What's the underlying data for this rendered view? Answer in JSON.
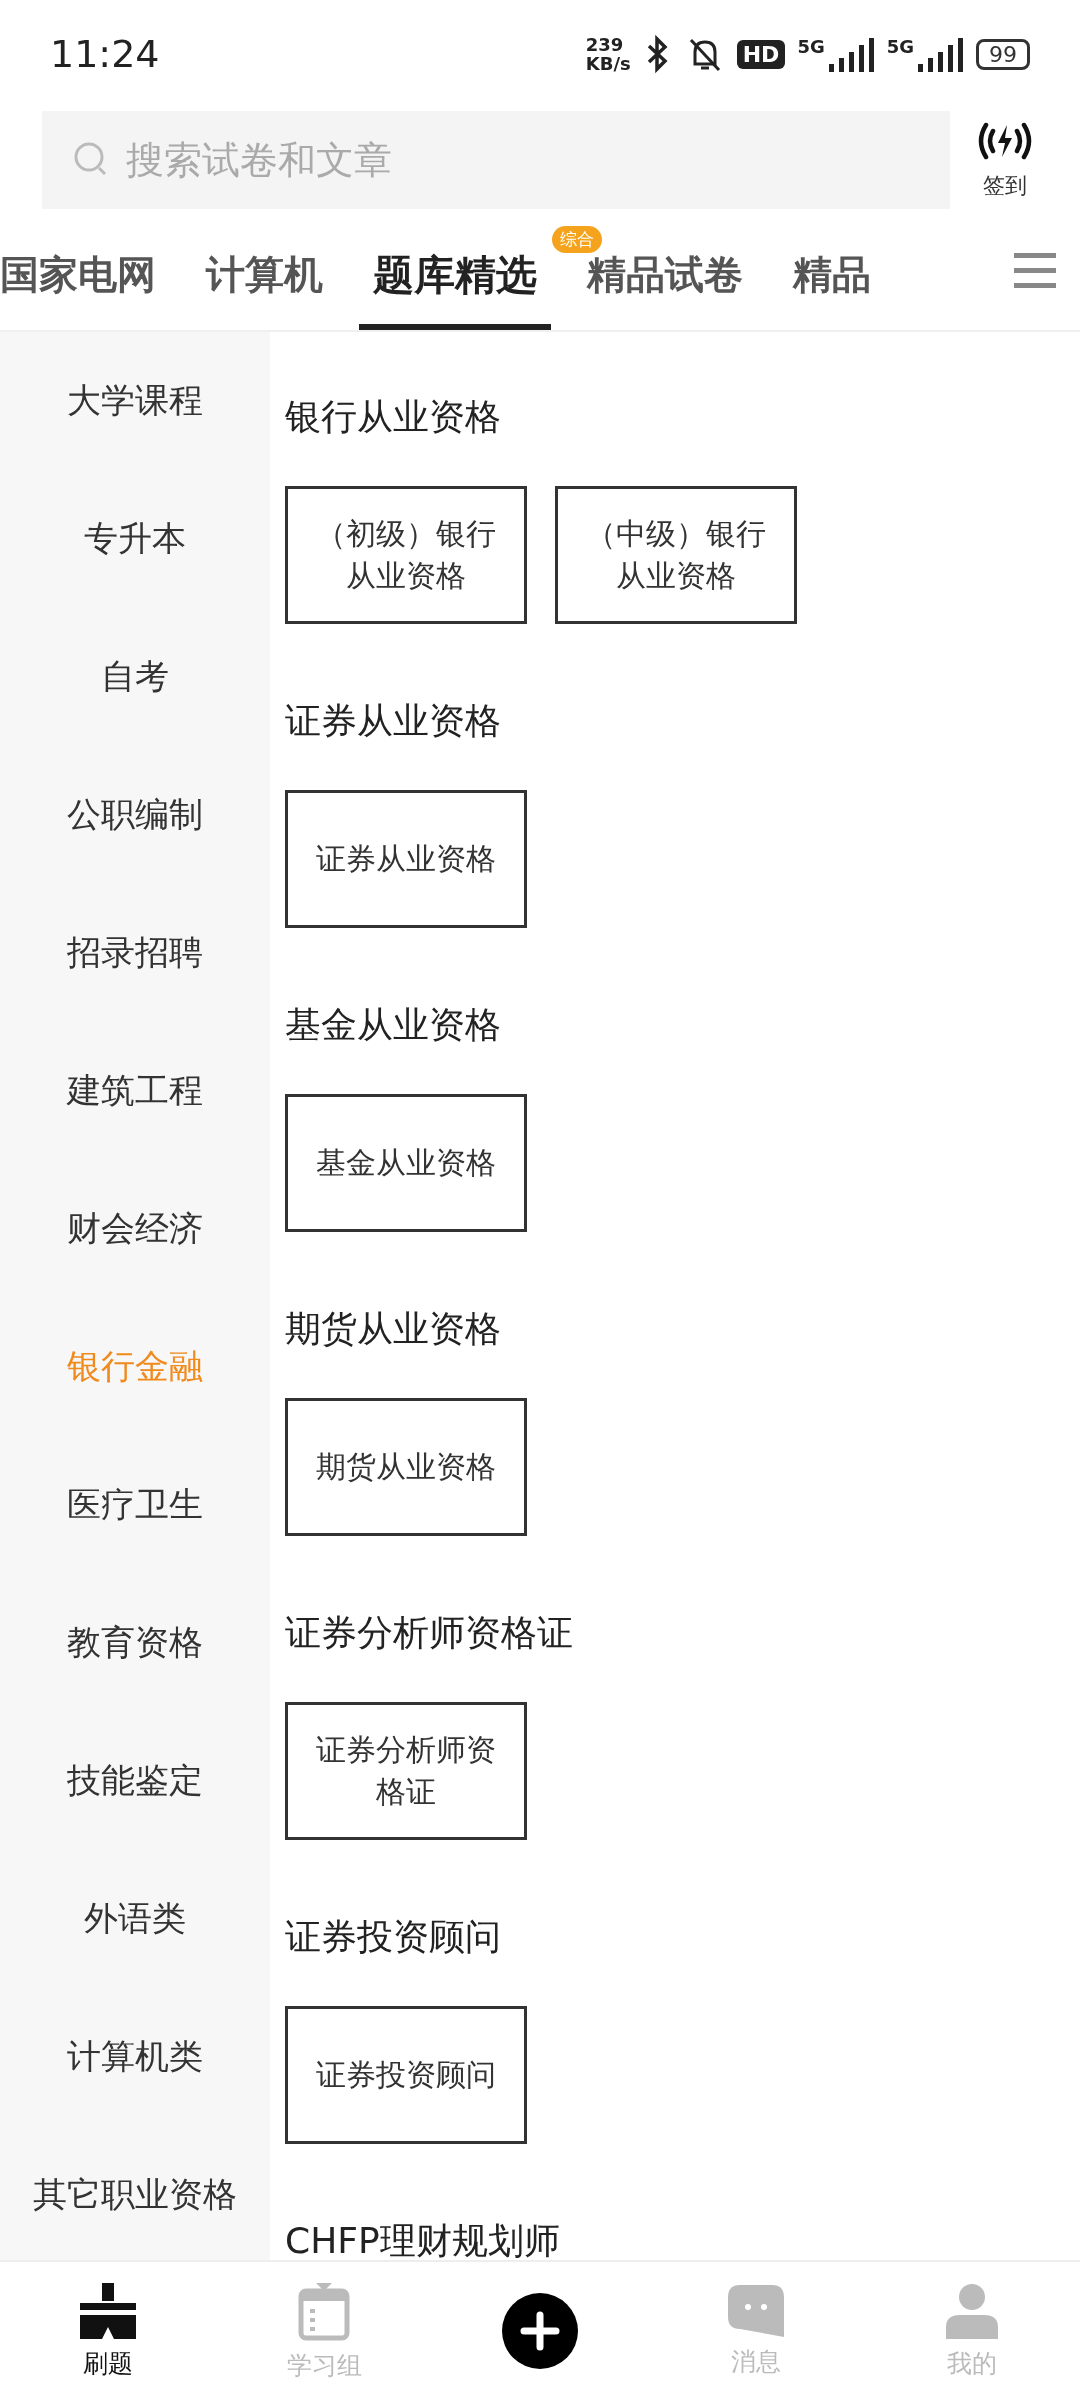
{
  "status_bar": {
    "time": "11:24",
    "net_speed_value": "239",
    "net_speed_unit": "KB/s",
    "battery": "99",
    "hd": "HD",
    "network_types": [
      "5G",
      "5G"
    ]
  },
  "search": {
    "placeholder": "搜索试卷和文章"
  },
  "checkin": {
    "label": "签到"
  },
  "tabs": [
    {
      "label": "国家电网",
      "selected": false
    },
    {
      "label": "计算机",
      "selected": false
    },
    {
      "label": "题库精选",
      "selected": true,
      "badge": "综合"
    },
    {
      "label": "精品试卷",
      "selected": false
    },
    {
      "label": "精品",
      "selected": false
    }
  ],
  "sidebar": {
    "items": [
      {
        "label": "大学课程",
        "selected": false
      },
      {
        "label": "专升本",
        "selected": false
      },
      {
        "label": "自考",
        "selected": false
      },
      {
        "label": "公职编制",
        "selected": false
      },
      {
        "label": "招录招聘",
        "selected": false
      },
      {
        "label": "建筑工程",
        "selected": false
      },
      {
        "label": "财会经济",
        "selected": false
      },
      {
        "label": "银行金融",
        "selected": true
      },
      {
        "label": "医疗卫生",
        "selected": false
      },
      {
        "label": "教育资格",
        "selected": false
      },
      {
        "label": "技能鉴定",
        "selected": false
      },
      {
        "label": "外语类",
        "selected": false
      },
      {
        "label": "计算机类",
        "selected": false
      },
      {
        "label": "其它职业资格",
        "selected": false
      }
    ]
  },
  "sections": [
    {
      "title": "银行从业资格",
      "items": [
        "（初级）银行从业资格",
        "（中级）银行从业资格"
      ]
    },
    {
      "title": "证券从业资格",
      "items": [
        "证券从业资格"
      ]
    },
    {
      "title": "基金从业资格",
      "items": [
        "基金从业资格"
      ]
    },
    {
      "title": "期货从业资格",
      "items": [
        "期货从业资格"
      ]
    },
    {
      "title": "证券分析师资格证",
      "items": [
        "证券分析师资格证"
      ]
    },
    {
      "title": "证券投资顾问",
      "items": [
        "证券投资顾问"
      ]
    },
    {
      "title": "CHFP理财规划师"
    }
  ],
  "bottom_nav": [
    {
      "label": "刷题",
      "selected": true
    },
    {
      "label": "学习组",
      "selected": false
    },
    {
      "label": "消息",
      "selected": false
    },
    {
      "label": "我的",
      "selected": false
    }
  ]
}
